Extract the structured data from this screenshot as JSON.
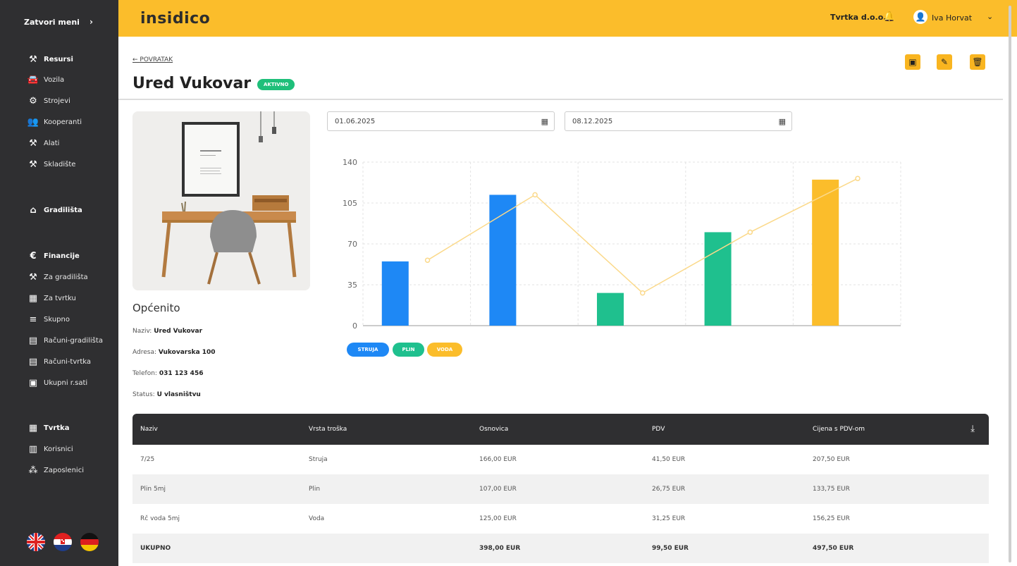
{
  "sidebar": {
    "toggle_label": "Zatvori meni",
    "resources": {
      "section": "Resursi",
      "items": [
        "Vozila",
        "Strojevi",
        "Kooperanti",
        "Alati",
        "Skladište"
      ]
    },
    "sites": {
      "section": "Gradilišta"
    },
    "finance": {
      "section": "Financije",
      "items": [
        "Za gradilišta",
        "Za tvrtku",
        "Skupno",
        "Računi-gradilišta",
        "Računi-tvrtka",
        "Ukupni r.sati"
      ]
    },
    "company": {
      "section": "Tvrtka",
      "items": [
        "Korisnici",
        "Zaposlenici"
      ]
    }
  },
  "topbar": {
    "logo": "insidico",
    "company": "Tvrtka d.o.o.",
    "user": "Iva Horvat"
  },
  "page": {
    "back": "POVRATAK",
    "title": "Ured Vukovar",
    "badge": "AKTIVNO"
  },
  "filters": {
    "date_from": "01.06.2025",
    "date_to": "08.12.2025"
  },
  "general": {
    "title": "Općenito",
    "name_label": "Naziv:",
    "name_value": "Ured Vukovar",
    "address_label": "Adresa:",
    "address_value": "Vukovarska 100",
    "phone_label": "Telefon:",
    "phone_value": "031 123 456",
    "status_label": "Status:",
    "status_value": "U vlasništvu"
  },
  "chart_data": {
    "type": "bar",
    "ylim": [
      0,
      140
    ],
    "yticks": [
      "140",
      "105",
      "70",
      "35",
      "0"
    ],
    "series": [
      {
        "name": "STRUJA",
        "color": "#1e88f5",
        "values": [
          55,
          112,
          null,
          null,
          null
        ]
      },
      {
        "name": "PLIN",
        "color": "#1fc08e",
        "values": [
          null,
          null,
          28,
          80,
          null
        ]
      },
      {
        "name": "VODA",
        "color": "#fbbd2b",
        "values": [
          null,
          null,
          null,
          null,
          125
        ]
      }
    ],
    "line": {
      "color": "#fbd98a",
      "values": [
        56,
        112,
        28,
        80,
        126
      ]
    }
  },
  "table": {
    "headers": [
      "Naziv",
      "Vrsta troška",
      "Osnovica",
      "PDV",
      "Cijena s PDV-om"
    ],
    "rows": [
      [
        "7/25",
        "Struja",
        "166,00 EUR",
        "41,50 EUR",
        "207,50 EUR"
      ],
      [
        "Plin 5mj",
        "Plin",
        "107,00 EUR",
        "26,75 EUR",
        "133,75 EUR"
      ],
      [
        "Rč voda 5mj",
        "Voda",
        "125,00 EUR",
        "31,25 EUR",
        "156,25 EUR"
      ]
    ],
    "total": [
      "UKUPNO",
      "",
      "398,00 EUR",
      "99,50 EUR",
      "497,50 EUR"
    ]
  }
}
